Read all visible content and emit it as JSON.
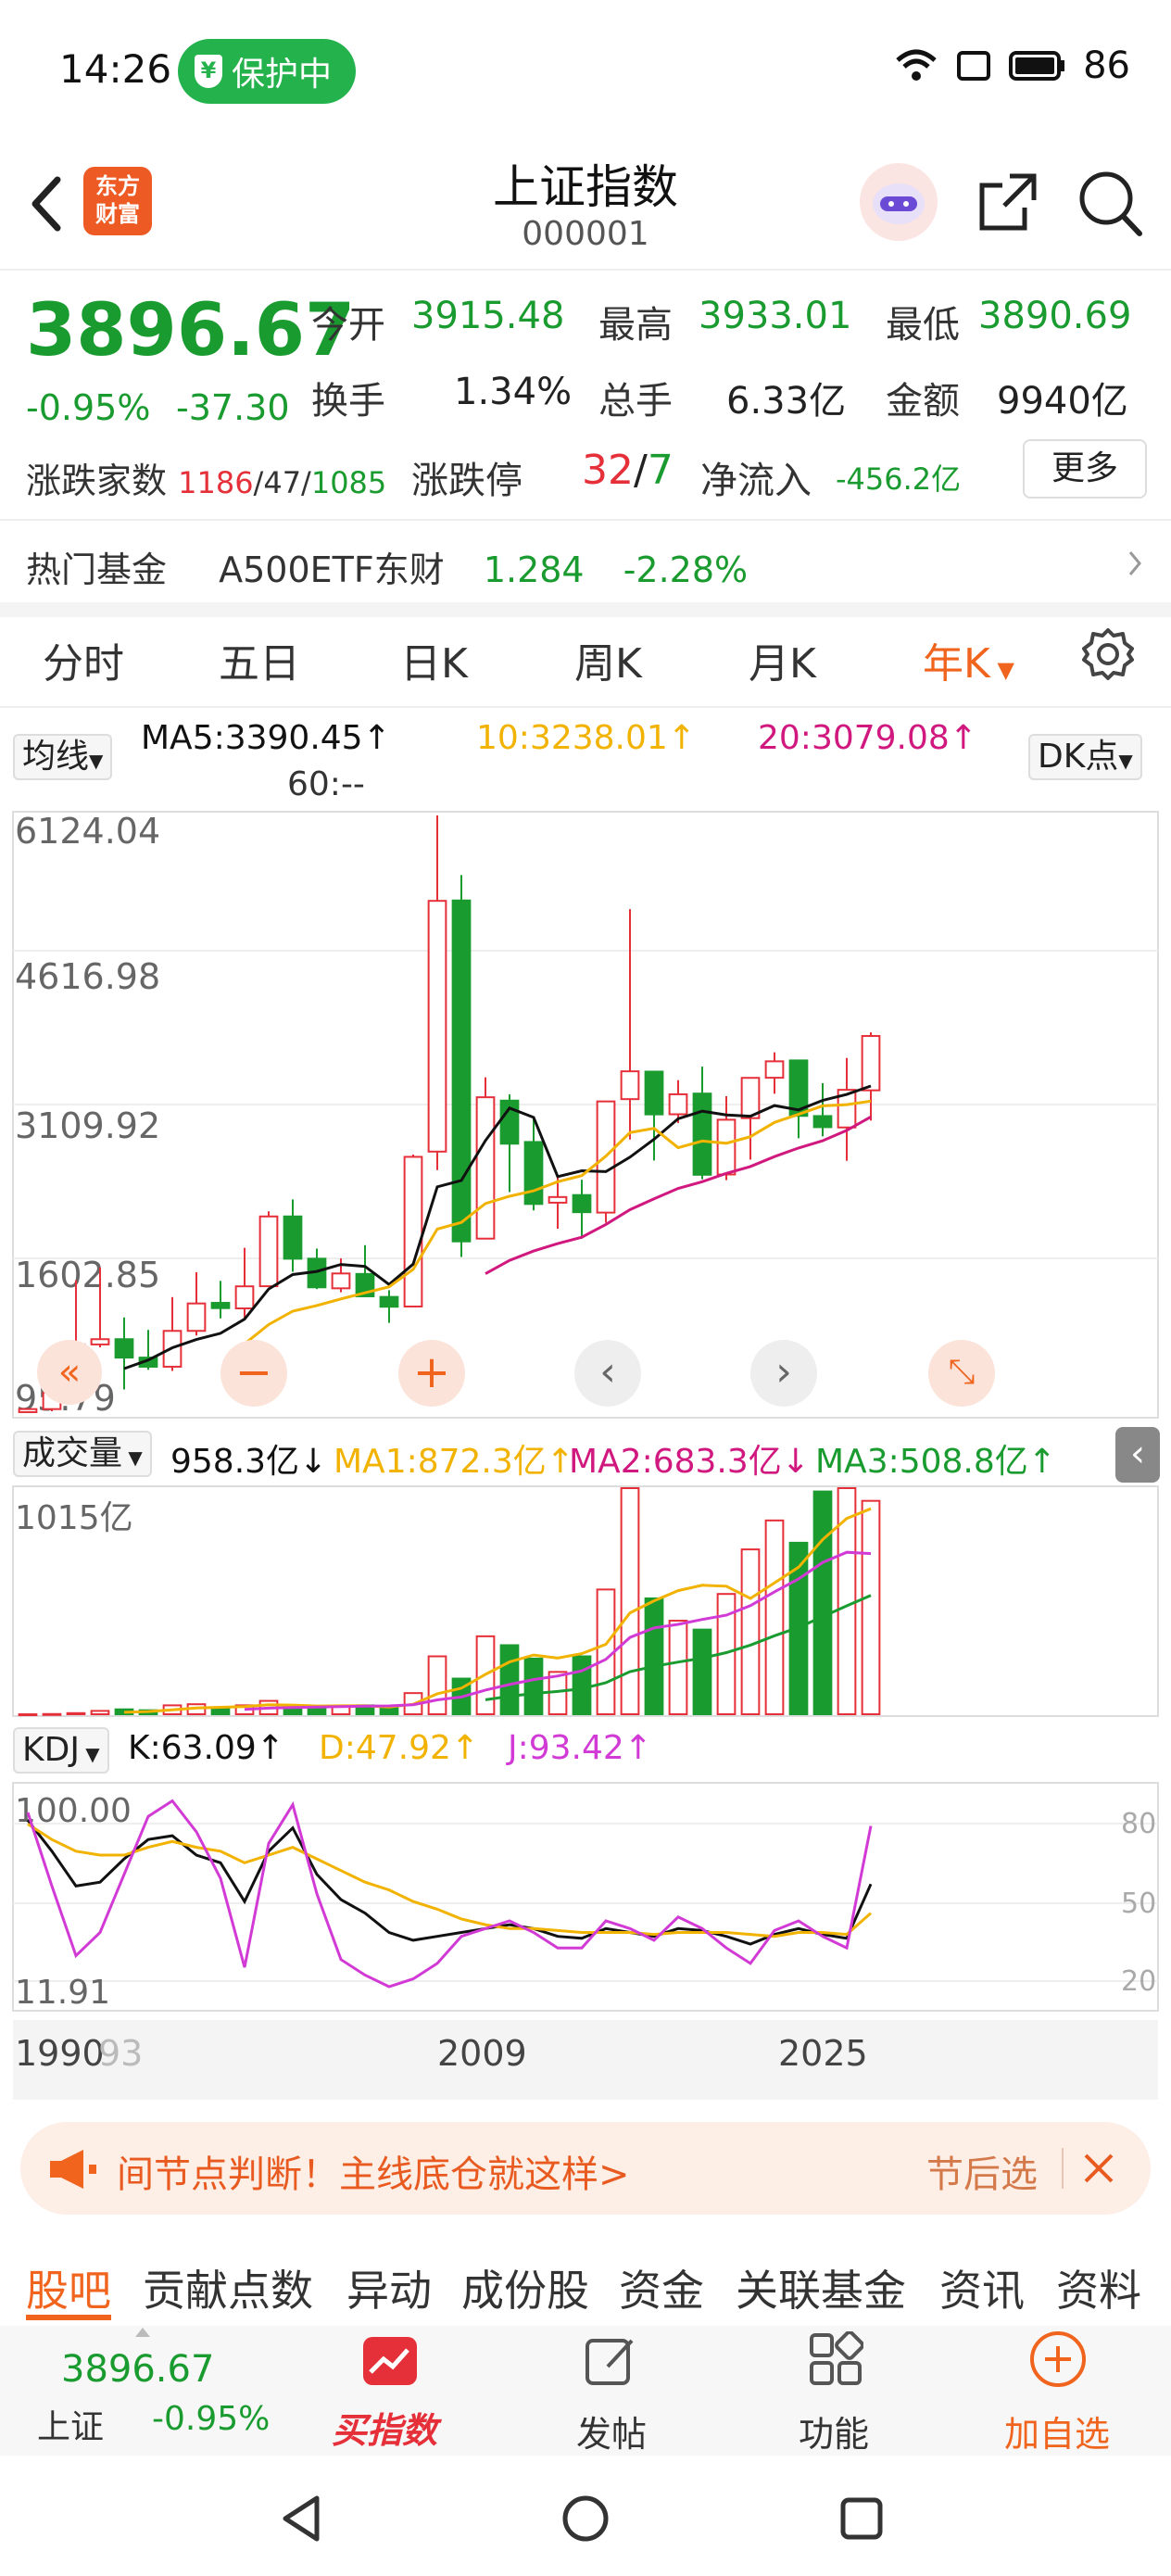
{
  "status": {
    "time": "14:26",
    "protect": "保护中",
    "battery": "86"
  },
  "header": {
    "logo": "东方财富",
    "title": "上证指数",
    "code": "000001"
  },
  "quote": {
    "price": "3896.67",
    "change_pct": "-0.95%",
    "change": "-37.30",
    "open_label": "今开",
    "open": "3915.48",
    "high_label": "最高",
    "high": "3933.01",
    "low_label": "最低",
    "low": "3890.69",
    "turnover_label": "换手",
    "turnover": "1.34%",
    "volume_label": "总手",
    "volume": "6.33亿",
    "amount_label": "金额",
    "amount": "9940亿",
    "breadth_label": "涨跌家数",
    "up": "1186",
    "flat": "47",
    "down": "1085",
    "limit_label": "涨跌停",
    "limit_up": "32",
    "limit_down": "7",
    "inflow_label": "净流入",
    "inflow": "-456.2亿",
    "more": "更多"
  },
  "fund": {
    "label": "热门基金",
    "name": "A500ETF东财",
    "price": "1.284",
    "pct": "-2.28%"
  },
  "ktabs": [
    "分时",
    "五日",
    "日K",
    "周K",
    "月K",
    "年K"
  ],
  "ma": {
    "selector": "均线",
    "ma5": "MA5:3390.45↑",
    "ma10": "10:3238.01↑",
    "ma20": "20:3079.08↑",
    "ma60": "60:--",
    "dk": "DK点"
  },
  "colors": {
    "up": "#e5303a",
    "down": "#1a9b2f",
    "accent": "#f0641e",
    "ma5": "#111111",
    "ma10": "#f2b200",
    "ma20": "#d0187f"
  },
  "main_chart": {
    "y_labels": [
      "6124.04",
      "4616.98",
      "3109.92",
      "1602.85",
      "95.79"
    ]
  },
  "vol": {
    "selector": "成交量",
    "value": "958.3亿↓",
    "ma1": "MA1:872.3亿↑",
    "ma2": "MA2:683.3亿↓",
    "ma3": "MA3:508.8亿↑",
    "ymax": "1015亿"
  },
  "kdj": {
    "selector": "KDJ",
    "k": "K:63.09↑",
    "d": "D:47.92↑",
    "j": "J:93.42↑",
    "ymax": "100.00",
    "ymin": "11.91",
    "r80": "80",
    "r50": "50",
    "r20": "20"
  },
  "xaxis": {
    "a": "1990",
    "b": "93",
    "c": "2009",
    "d": "2025"
  },
  "chart_data": [
    {
      "type": "candlestick",
      "title": "上证指数 年K",
      "ylim": [
        95.79,
        6124.04
      ],
      "x": [
        "1990",
        "1991",
        "1992",
        "1993",
        "1994",
        "1995",
        "1996",
        "1997",
        "1998",
        "1999",
        "2000",
        "2001",
        "2002",
        "2003",
        "2004",
        "2005",
        "2006",
        "2007",
        "2008",
        "2009",
        "2010",
        "2011",
        "2012",
        "2013",
        "2014",
        "2015",
        "2016",
        "2017",
        "2018",
        "2019",
        "2020",
        "2021",
        "2022",
        "2023",
        "2024",
        "2025"
      ],
      "open": [
        96,
        127,
        293,
        780,
        833,
        647,
        555,
        917,
        1200,
        1144,
        1368,
        2073,
        1646,
        1347,
        1492,
        1260,
        1163,
        2728,
        5265,
        1849,
        3243,
        2825,
        2212,
        2289,
        2112,
        3258,
        3536,
        3105,
        3314,
        2497,
        3066,
        3474,
        3649,
        3087,
        2972,
        3347
      ],
      "close": [
        127,
        293,
        780,
        833,
        647,
        555,
        917,
        1194,
        1147,
        1367,
        2073,
        1646,
        1357,
        1497,
        1266,
        1161,
        2675,
        5261,
        1821,
        3277,
        2808,
        2199,
        2269,
        2116,
        3235,
        3539,
        3104,
        3307,
        2494,
        3050,
        3473,
        3640,
        3089,
        2975,
        3352,
        3896
      ],
      "high": [
        127,
        293,
        1429,
        1558,
        1053,
        927,
        1258,
        1510,
        1422,
        1756,
        2125,
        2245,
        1748,
        1649,
        1783,
        1328,
        2698,
        6124,
        5522,
        3478,
        3306,
        3067,
        2478,
        2444,
        3239,
        5178,
        3539,
        3450,
        3587,
        3288,
        3474,
        3731,
        3652,
        3419,
        3674,
        3933
      ],
      "low": [
        95,
        105,
        293,
        750,
        325,
        524,
        512,
        870,
        1043,
        1047,
        1361,
        1514,
        1339,
        1307,
        1259,
        998,
        1161,
        2541,
        1664,
        1844,
        2319,
        2134,
        1949,
        1849,
        2010,
        2850,
        2638,
        3017,
        2449,
        2440,
        2647,
        3312,
        2863,
        2882,
        2635,
        3041
      ]
    },
    {
      "type": "bar",
      "title": "成交量",
      "x": [
        "1990",
        "1991",
        "1992",
        "1993",
        "1994",
        "1995",
        "1996",
        "1997",
        "1998",
        "1999",
        "2000",
        "2001",
        "2002",
        "2003",
        "2004",
        "2005",
        "2006",
        "2007",
        "2008",
        "2009",
        "2010",
        "2011",
        "2012",
        "2013",
        "2014",
        "2015",
        "2016",
        "2017",
        "2018",
        "2019",
        "2020",
        "2021",
        "2022",
        "2023",
        "2024",
        "2025"
      ],
      "values": [
        0,
        1,
        5,
        15,
        22,
        18,
        40,
        45,
        30,
        40,
        60,
        30,
        25,
        35,
        40,
        30,
        95,
        260,
        160,
        350,
        310,
        250,
        190,
        260,
        560,
        1015,
        520,
        420,
        380,
        540,
        740,
        870,
        770,
        1000,
        1015,
        958
      ]
    },
    {
      "type": "line",
      "title": "KDJ",
      "ylim": [
        11.91,
        100
      ],
      "x": [
        "1990",
        "1991",
        "1992",
        "1993",
        "1994",
        "1995",
        "1996",
        "1997",
        "1998",
        "1999",
        "2000",
        "2001",
        "2002",
        "2003",
        "2004",
        "2005",
        "2006",
        "2007",
        "2008",
        "2009",
        "2010",
        "2011",
        "2012",
        "2013",
        "2014",
        "2015",
        "2016",
        "2017",
        "2018",
        "2019",
        "2020",
        "2021",
        "2022",
        "2023",
        "2024",
        "2025"
      ],
      "series": [
        {
          "name": "K",
          "values": [
            96,
            80,
            62,
            64,
            76,
            86,
            88,
            78,
            74,
            54,
            80,
            92,
            68,
            55,
            48,
            38,
            34,
            36,
            38,
            40,
            42,
            40,
            36,
            35,
            40,
            38,
            36,
            40,
            39,
            36,
            32,
            37,
            40,
            37,
            35,
            63
          ]
        },
        {
          "name": "D",
          "values": [
            94,
            86,
            80,
            78,
            78,
            82,
            85,
            82,
            80,
            74,
            78,
            82,
            76,
            70,
            64,
            60,
            54,
            50,
            45,
            42,
            40,
            40,
            39,
            38,
            38,
            38,
            37,
            38,
            38,
            38,
            37,
            36,
            38,
            38,
            37,
            48
          ]
        },
        {
          "name": "J",
          "values": [
            100,
            62,
            26,
            38,
            68,
            98,
            108,
            90,
            66,
            20,
            84,
            104,
            58,
            24,
            16,
            10,
            14,
            22,
            36,
            40,
            44,
            38,
            30,
            30,
            44,
            40,
            34,
            46,
            40,
            30,
            22,
            39,
            44,
            36,
            30,
            93
          ]
        }
      ]
    }
  ],
  "banner": {
    "text": "间节点判断！主线底仓就这样>",
    "side": "节后选"
  },
  "tabs2": [
    "股吧",
    "贡献点数",
    "异动",
    "成份股",
    "资金",
    "关联基金",
    "资讯",
    "资料"
  ],
  "bottom": {
    "price": "3896.67",
    "name": "上证",
    "pct": "-0.95%",
    "buy": "买指数",
    "post": "发帖",
    "func": "功能",
    "add": "加自选"
  }
}
